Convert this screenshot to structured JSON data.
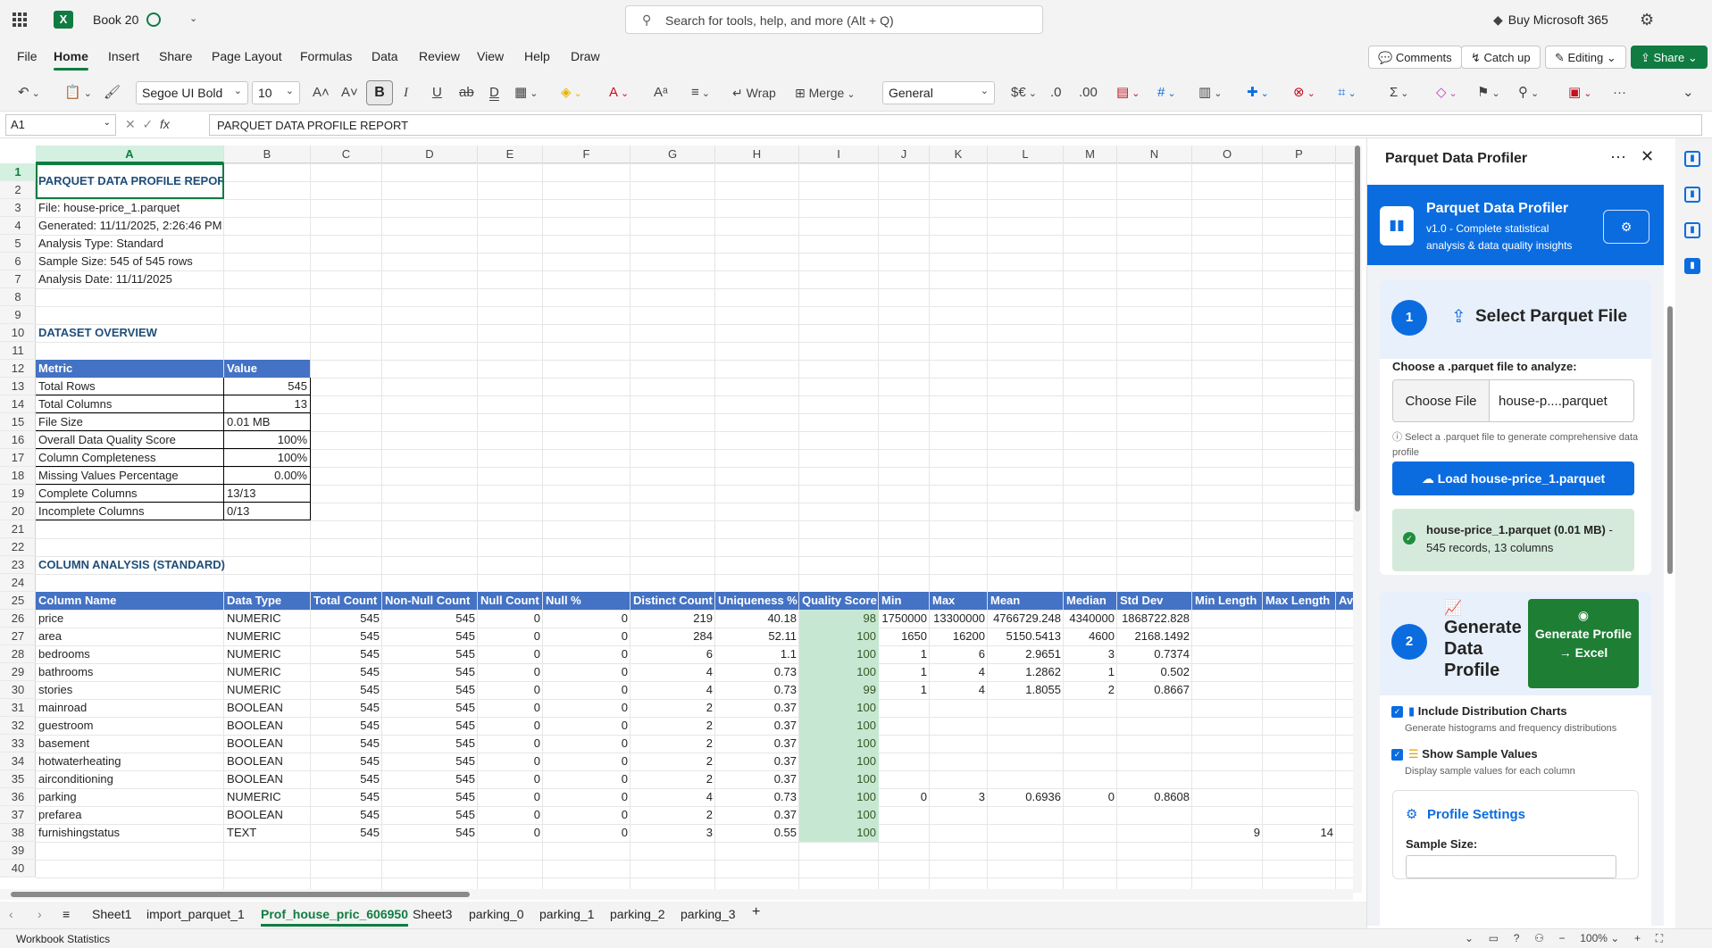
{
  "app": {
    "doc_name": "Book 20",
    "search_placeholder": "Search for tools, help, and more (Alt + Q)",
    "buy_label": "Buy Microsoft 365"
  },
  "menu": {
    "tabs": [
      "File",
      "Home",
      "Insert",
      "Share",
      "Page Layout",
      "Formulas",
      "Data",
      "Review",
      "View",
      "Help",
      "Draw"
    ],
    "comments": "Comments",
    "catchup": "Catch up",
    "editing": "Editing",
    "share": "Share"
  },
  "ribbon": {
    "font_name": "Segoe UI Bold",
    "font_size": "10",
    "wrap": "Wrap",
    "merge": "Merge",
    "number_format": "General"
  },
  "formula_bar": {
    "cell_ref": "A1",
    "content": "PARQUET DATA PROFILE REPORT"
  },
  "columns": [
    "A",
    "B",
    "C",
    "D",
    "E",
    "F",
    "G",
    "H",
    "I",
    "J",
    "K",
    "L",
    "M",
    "N",
    "O",
    "P"
  ],
  "rows": [
    "1",
    "2",
    "3",
    "4",
    "5",
    "6",
    "7",
    "8",
    "9",
    "10",
    "11",
    "12",
    "13",
    "14",
    "15",
    "16",
    "17",
    "18",
    "19",
    "20",
    "21",
    "22",
    "23",
    "24",
    "25",
    "26",
    "27",
    "28",
    "29",
    "30",
    "31",
    "32",
    "33",
    "34",
    "35",
    "36",
    "37",
    "38",
    "39",
    "40"
  ],
  "report": {
    "title": "PARQUET DATA PROFILE REPORT",
    "info": [
      "File: house-price_1.parquet",
      "Generated: 11/11/2025, 2:26:46 PM",
      "Analysis Type: Standard",
      "Sample Size: 545 of 545 rows",
      "Analysis Date: 11/11/2025"
    ],
    "overview_title": "DATASET OVERVIEW",
    "overview_headers": [
      "Metric",
      "Value"
    ],
    "overview": [
      [
        "Total Rows",
        "545"
      ],
      [
        "Total Columns",
        "13"
      ],
      [
        "File Size",
        "0.01 MB"
      ],
      [
        "Overall Data Quality Score",
        "100%"
      ],
      [
        "Column Completeness",
        "100%"
      ],
      [
        "Missing Values Percentage",
        "0.00%"
      ],
      [
        "Complete Columns",
        "13/13"
      ],
      [
        "Incomplete Columns",
        "0/13"
      ]
    ],
    "analysis_title": "COLUMN ANALYSIS (STANDARD)",
    "analysis_headers": [
      "Column Name",
      "Data Type",
      "Total Count",
      "Non-Null Count",
      "Null Count",
      "Null %",
      "Distinct Count",
      "Uniqueness %",
      "Quality Score",
      "Min",
      "Max",
      "Mean",
      "Median",
      "Std Dev",
      "Min Length",
      "Max Length",
      "Avg L"
    ],
    "analysis": [
      [
        "price",
        "NUMERIC",
        "545",
        "545",
        "0",
        "0",
        "219",
        "40.18",
        "98",
        "1750000",
        "13300000",
        "4766729.248",
        "4340000",
        "1868722.828",
        "",
        ""
      ],
      [
        "area",
        "NUMERIC",
        "545",
        "545",
        "0",
        "0",
        "284",
        "52.11",
        "100",
        "1650",
        "16200",
        "5150.5413",
        "4600",
        "2168.1492",
        "",
        ""
      ],
      [
        "bedrooms",
        "NUMERIC",
        "545",
        "545",
        "0",
        "0",
        "6",
        "1.1",
        "100",
        "1",
        "6",
        "2.9651",
        "3",
        "0.7374",
        "",
        ""
      ],
      [
        "bathrooms",
        "NUMERIC",
        "545",
        "545",
        "0",
        "0",
        "4",
        "0.73",
        "100",
        "1",
        "4",
        "1.2862",
        "1",
        "0.502",
        "",
        ""
      ],
      [
        "stories",
        "NUMERIC",
        "545",
        "545",
        "0",
        "0",
        "4",
        "0.73",
        "99",
        "1",
        "4",
        "1.8055",
        "2",
        "0.8667",
        "",
        ""
      ],
      [
        "mainroad",
        "BOOLEAN",
        "545",
        "545",
        "0",
        "0",
        "2",
        "0.37",
        "100",
        "",
        "",
        "",
        "",
        "",
        "",
        ""
      ],
      [
        "guestroom",
        "BOOLEAN",
        "545",
        "545",
        "0",
        "0",
        "2",
        "0.37",
        "100",
        "",
        "",
        "",
        "",
        "",
        "",
        ""
      ],
      [
        "basement",
        "BOOLEAN",
        "545",
        "545",
        "0",
        "0",
        "2",
        "0.37",
        "100",
        "",
        "",
        "",
        "",
        "",
        "",
        ""
      ],
      [
        "hotwaterheating",
        "BOOLEAN",
        "545",
        "545",
        "0",
        "0",
        "2",
        "0.37",
        "100",
        "",
        "",
        "",
        "",
        "",
        "",
        ""
      ],
      [
        "airconditioning",
        "BOOLEAN",
        "545",
        "545",
        "0",
        "0",
        "2",
        "0.37",
        "100",
        "",
        "",
        "",
        "",
        "",
        "",
        ""
      ],
      [
        "parking",
        "NUMERIC",
        "545",
        "545",
        "0",
        "0",
        "4",
        "0.73",
        "100",
        "0",
        "3",
        "0.6936",
        "0",
        "0.8608",
        "",
        ""
      ],
      [
        "prefarea",
        "BOOLEAN",
        "545",
        "545",
        "0",
        "0",
        "2",
        "0.37",
        "100",
        "",
        "",
        "",
        "",
        "",
        "",
        ""
      ],
      [
        "furnishingstatus",
        "TEXT",
        "545",
        "545",
        "0",
        "0",
        "3",
        "0.55",
        "100",
        "",
        "",
        "",
        "",
        "",
        "9",
        "14"
      ]
    ]
  },
  "sheets": [
    "Sheet1",
    "import_parquet_1",
    "Prof_house_pric_606950",
    "Sheet3",
    "parking_0",
    "parking_1",
    "parking_2",
    "parking_3"
  ],
  "active_sheet": "Prof_house_pric_606950",
  "status": {
    "left": "Workbook Statistics",
    "zoom": "100%"
  },
  "panel": {
    "title": "Parquet Data Profiler",
    "header_title": "Parquet Data Profiler",
    "header_sub": "v1.0 - Complete statistical analysis & data quality insights",
    "step1_num": "1",
    "step1_title": "Select Parquet File",
    "choose_label": "Choose a .parquet file to analyze:",
    "choose_file": "Choose File",
    "file_name": "house-p....parquet",
    "hint": "Select a .parquet file to generate comprehensive data profile",
    "load_btn": "Load house-price_1.parquet",
    "success_title": "house-price_1.parquet (0.01 MB)",
    "success_sep": "-",
    "success_sub": "545 records, 13 columns",
    "step2_num": "2",
    "step2_title": "Generate Data Profile",
    "generate_btn": "Generate Profile → Excel",
    "opt1_label": "Include Distribution Charts",
    "opt1_desc": "Generate histograms and frequency distributions",
    "opt2_label": "Show Sample Values",
    "opt2_desc": "Display sample values for each column",
    "settings_title": "Profile Settings",
    "sample_size_label": "Sample Size:"
  },
  "colors": {
    "excel_green": "#107c41",
    "table_header": "#4472c4",
    "quality_fill": "#c6e8d2",
    "panel_blue": "#0b6ce0",
    "generate_green": "#1e7e34"
  }
}
